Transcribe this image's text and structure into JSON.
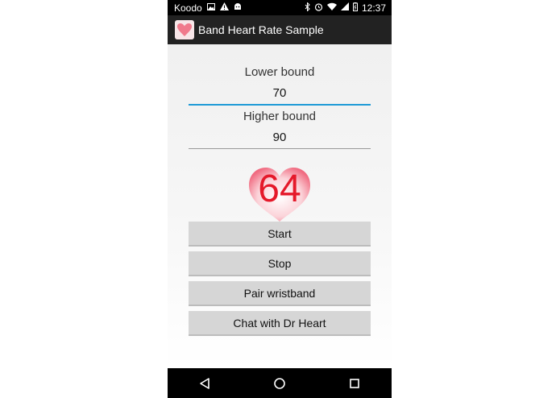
{
  "status_bar": {
    "carrier": "Koodo",
    "time": "12:37",
    "left_icons": [
      "image-icon",
      "warning-icon",
      "android-icon"
    ],
    "right_icons": [
      "bluetooth-icon",
      "alarm-icon",
      "wifi-icon",
      "signal-icon",
      "battery-icon"
    ]
  },
  "action_bar": {
    "title": "Band Heart Rate Sample",
    "icon": "heart-app-icon"
  },
  "form": {
    "lower_label": "Lower bound",
    "lower_value": "70",
    "higher_label": "Higher bound",
    "higher_value": "90"
  },
  "heart_rate": {
    "value": "64",
    "color": "#e5192a"
  },
  "buttons": {
    "start": "Start",
    "stop": "Stop",
    "pair": "Pair wristband",
    "chat": "Chat with Dr Heart"
  },
  "nav_bar": {
    "icons": [
      "back-icon",
      "home-icon",
      "recents-icon"
    ]
  }
}
